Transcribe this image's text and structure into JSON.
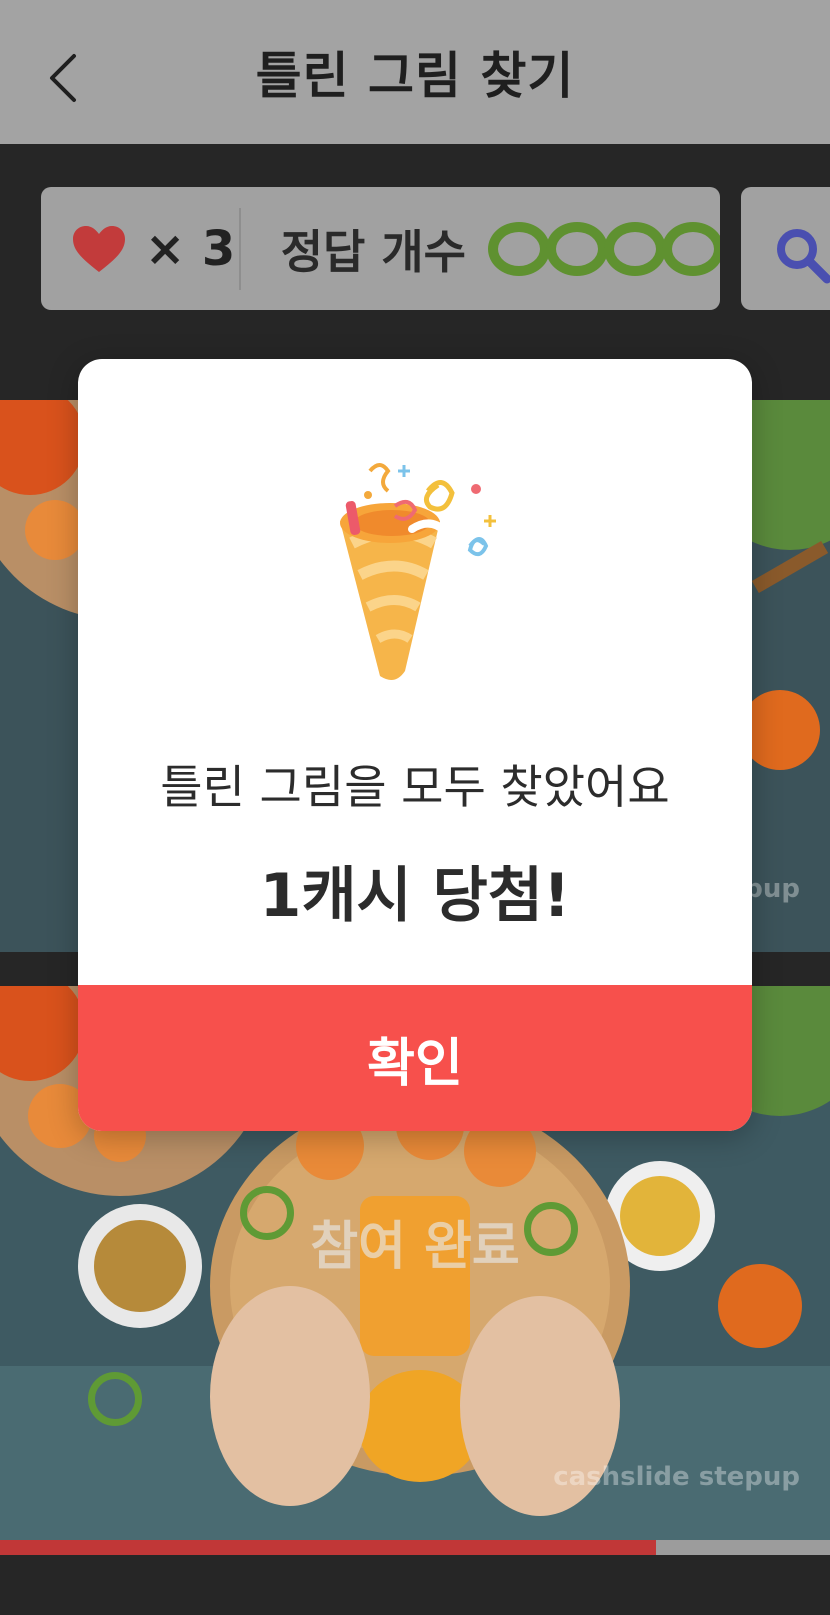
{
  "header": {
    "title": "틀린 그림 찾기",
    "back_icon": "chevron-left-icon"
  },
  "status": {
    "lives_icon": "heart-icon",
    "lives_text": "× 3",
    "answers_label": "정답 개수",
    "answers_found": 4,
    "hint_icon": "magnifier-icon"
  },
  "game": {
    "watermark": "cashslide stepup",
    "watermark_top": "pup",
    "completed_label": "참여 완료",
    "progress": 0.79
  },
  "modal": {
    "icon": "party-popper-icon",
    "message": "틀린 그림을 모두 찾았어요",
    "reward": "1캐시 당첨!",
    "confirm_label": "확인"
  },
  "colors": {
    "accent": "#f7504c",
    "found_ring": "#5f9130",
    "heart": "#d63a3a",
    "progress": "#c13737"
  }
}
